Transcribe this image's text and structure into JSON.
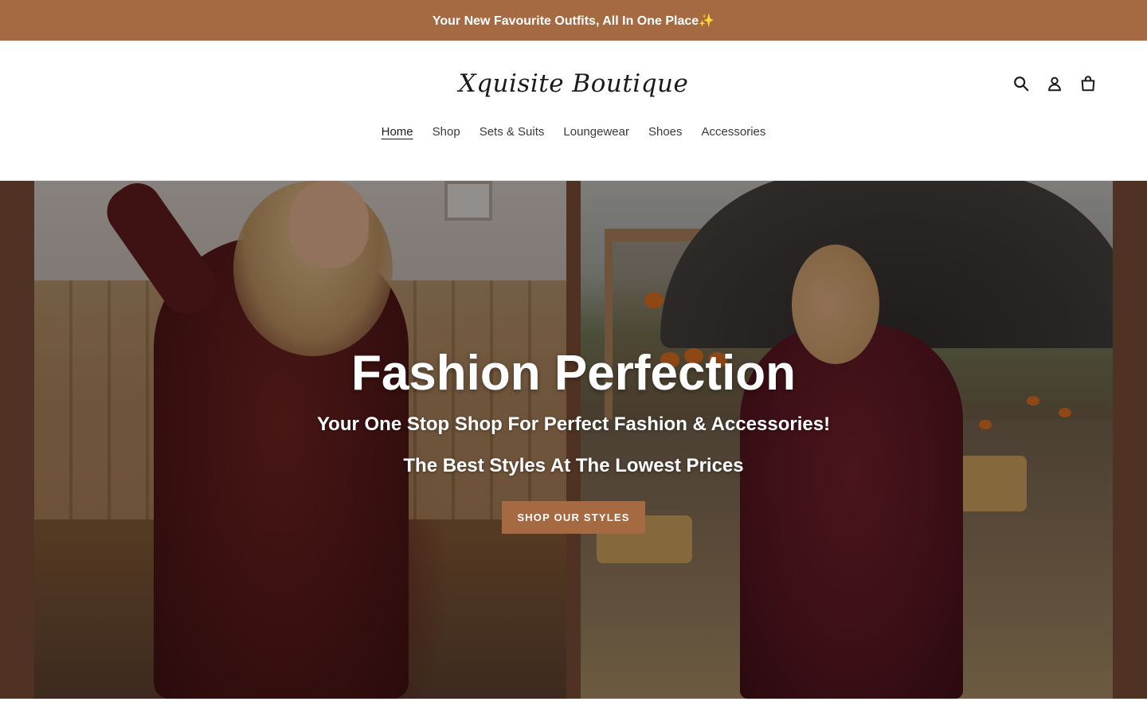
{
  "announcement": {
    "text": "Your New Favourite Outfits, All In One Place✨"
  },
  "header": {
    "logo_text": "Xquisite Boutique",
    "icons": [
      "search-icon",
      "account-icon",
      "cart-icon"
    ]
  },
  "nav": {
    "items": [
      {
        "label": "Home",
        "active": true
      },
      {
        "label": "Shop",
        "active": false
      },
      {
        "label": "Sets & Suits",
        "active": false
      },
      {
        "label": "Loungewear",
        "active": false
      },
      {
        "label": "Shoes",
        "active": false
      },
      {
        "label": "Accessories",
        "active": false
      }
    ]
  },
  "hero": {
    "title": "Fashion Perfection",
    "subtitle_1": "Your One Stop Shop For Perfect Fashion & Accessories!",
    "subtitle_2": "The Best Styles At The Lowest Prices",
    "cta_label": "SHOP OUR STYLES"
  },
  "colors": {
    "brand": "#a66a42",
    "hero_bg": "#764a35",
    "text_dark": "#1b1b1b"
  }
}
